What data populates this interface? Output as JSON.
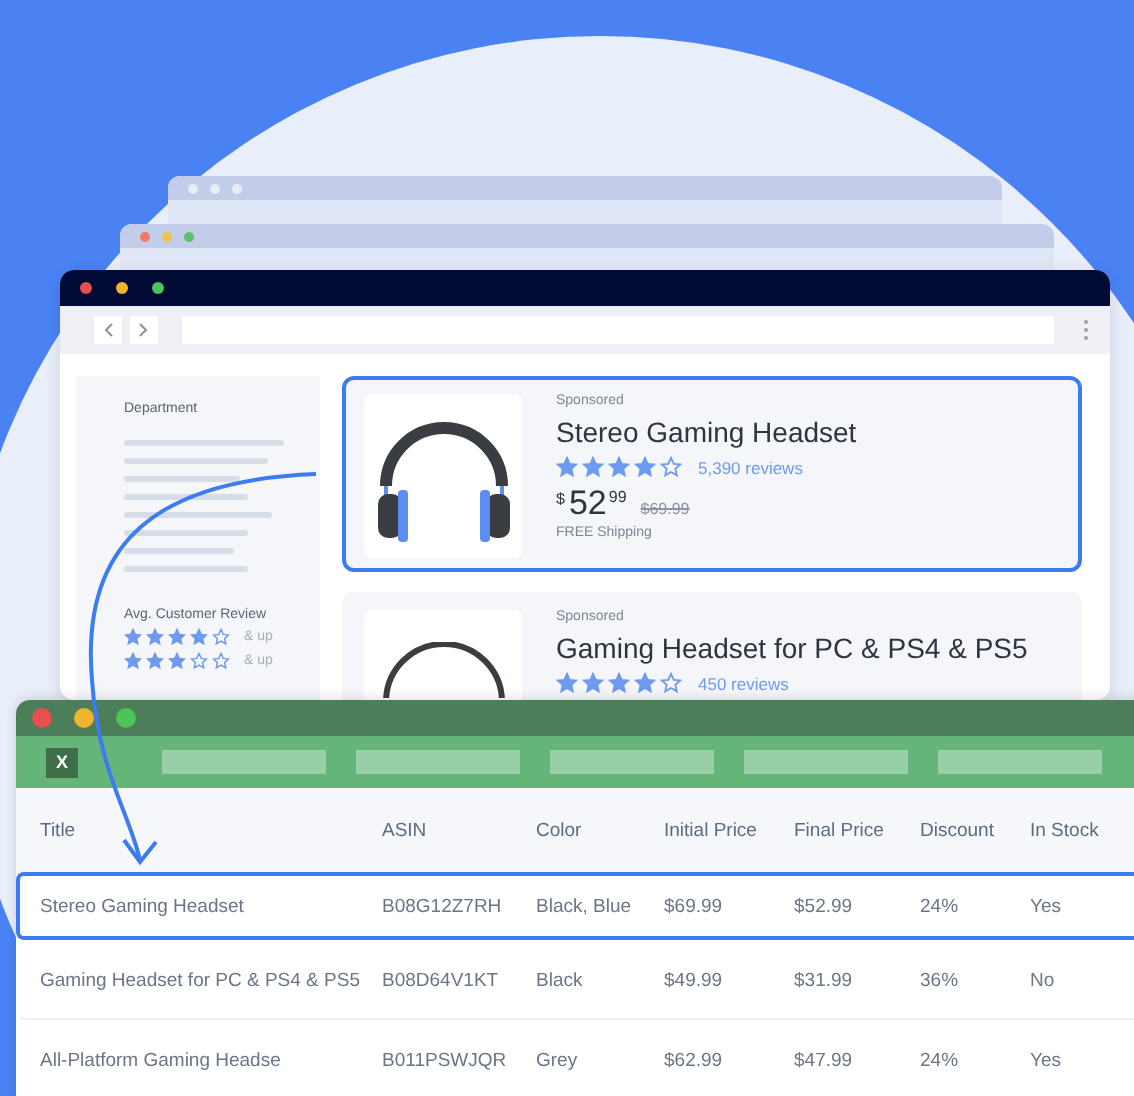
{
  "browser": {
    "sidebar": {
      "heading": "Department",
      "review_heading": "Avg. Customer Review",
      "review_filters": [
        {
          "stars": 4,
          "label": "& up"
        },
        {
          "stars": 3,
          "label": "& up"
        }
      ]
    },
    "products": [
      {
        "badge": "Sponsored",
        "title": "Stereo Gaming Headset",
        "stars": 4,
        "reviews": "5,390 reviews",
        "currency": "$",
        "price_whole": "52",
        "price_cents": "99",
        "list_price": "$69.99",
        "shipping": "FREE Shipping",
        "selected": true
      },
      {
        "badge": "Sponsored",
        "title": "Gaming Headset for PC & PS4 & PS5",
        "stars": 4,
        "reviews": "450 reviews",
        "selected": false
      }
    ]
  },
  "spreadsheet": {
    "app_icon": "X",
    "columns": [
      "Title",
      "ASIN",
      "Color",
      "Initial Price",
      "Final Price",
      "Discount",
      "In Stock"
    ],
    "rows": [
      {
        "cells": [
          "Stereo Gaming Headset",
          "B08G12Z7RH",
          "Black, Blue",
          "$69.99",
          "$52.99",
          "24%",
          "Yes"
        ],
        "selected": true
      },
      {
        "cells": [
          "Gaming Headset for PC & PS4 & PS5",
          "B08D64V1KT",
          "Black",
          "$49.99",
          "$31.99",
          "36%",
          "No"
        ],
        "selected": false
      },
      {
        "cells": [
          "All-Platform Gaming Headse",
          "B011PSWJQR",
          "Grey",
          "$62.99",
          "$47.99",
          "24%",
          "Yes"
        ],
        "selected": false
      }
    ]
  }
}
